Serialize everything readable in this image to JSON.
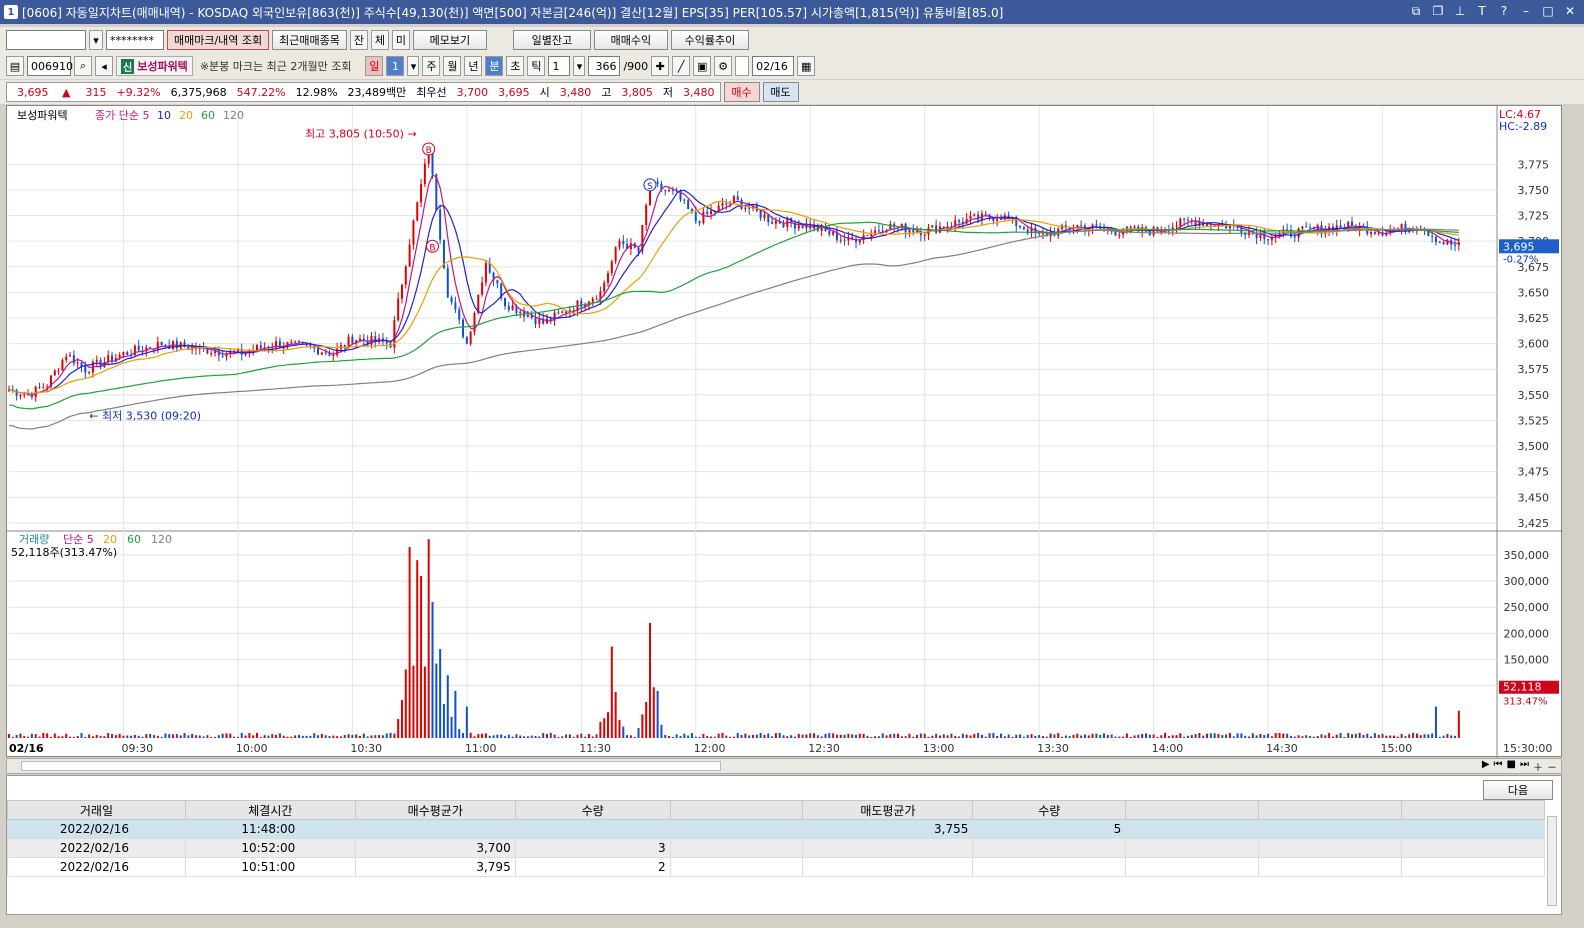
{
  "window": {
    "num": "1",
    "title": "[0606] 자동일지차트(매매내역) - KOSDAQ 외국인보유[863(천)] 주식수[49,130(천)] 액면[500] 자본금[246(억)] 결산[12월] EPS[35] PER[105.57] 시가총액[1,815(억)] 유통비율[85.0]"
  },
  "toolbar1": {
    "account": "",
    "password": "********",
    "mark_btn": "매매마크/내역 조회",
    "recent_btn": "최근매매종목",
    "jan": "잔",
    "che": "체",
    "mi": "미",
    "memo_btn": "메모보기",
    "daily_btn": "일별잔고",
    "profit_btn": "매매수익",
    "yield_btn": "수익률추이"
  },
  "toolbar2": {
    "code": "006910",
    "sin": "신",
    "name": "보성파워텍",
    "note": "※분봉 마크는 최근 2개월만 조회",
    "il": "일",
    "one": "1",
    "ju": "주",
    "wol": "월",
    "nyeon": "년",
    "bun": "분",
    "cho": "초",
    "tik": "틱",
    "interval": "1",
    "count": "366",
    "count_max": "/900",
    "date": "02/16"
  },
  "quote": {
    "price": "3,695",
    "arrow": "▲",
    "change": "315",
    "pct": "+9.32%",
    "volume": "6,375,968",
    "vol_pct": "547.22%",
    "turnover": "12.98%",
    "amount": "23,489백만",
    "order_label": "최우선",
    "ask": "3,700",
    "bid": "3,695",
    "open_label": "시",
    "open": "3,480",
    "high_label": "고",
    "high": "3,805",
    "low_label": "저",
    "low": "3,480",
    "buy_btn": "매수",
    "sell_btn": "매도"
  },
  "chart_data": [
    {
      "type": "line",
      "title": "보성파워텍",
      "legend": [
        "종가 단순 5",
        "10",
        "20",
        "60",
        "120"
      ],
      "colors": {
        "5": "#c0158a",
        "10": "#2020d0",
        "20": "#e8a000",
        "60": "#20a040",
        "120": "#808080",
        "up": "#e00000",
        "down": "#1050d0"
      },
      "ylim": [
        3420,
        3830
      ],
      "yticks": [
        3425,
        3450,
        3475,
        3500,
        3525,
        3550,
        3575,
        3600,
        3625,
        3650,
        3675,
        3700,
        3725,
        3750,
        3775
      ],
      "xticks": [
        "09:30",
        "10:00",
        "10:30",
        "11:00",
        "11:30",
        "12:00",
        "12:30",
        "13:00",
        "13:30",
        "14:00",
        "14:30",
        "15:00"
      ],
      "x_first_label": "02/16",
      "x_last_label": "15:30:00",
      "high_annotation": "최고 3,805 (10:50)",
      "low_annotation": "최저 3,530 (09:20)",
      "lc_label": "LC:4.67",
      "hc_label": "HC:-2.89",
      "current_price": "3,695",
      "current_pct": "-0.27%",
      "buy_markers": [
        {
          "t": "10:50",
          "price": 3790
        },
        {
          "t": "10:51",
          "price": 3695
        }
      ],
      "sell_markers": [
        {
          "t": "11:48",
          "price": 3755
        }
      ],
      "close_keyframes": [
        [
          "09:00",
          3555
        ],
        [
          "09:05",
          3550
        ],
        [
          "09:10",
          3560
        ],
        [
          "09:15",
          3590
        ],
        [
          "09:20",
          3575
        ],
        [
          "09:30",
          3590
        ],
        [
          "09:40",
          3600
        ],
        [
          "09:50",
          3595
        ],
        [
          "10:00",
          3590
        ],
        [
          "10:10",
          3600
        ],
        [
          "10:20",
          3595
        ],
        [
          "10:25",
          3590
        ],
        [
          "10:30",
          3605
        ],
        [
          "10:40",
          3600
        ],
        [
          "10:45",
          3700
        ],
        [
          "10:50",
          3790
        ],
        [
          "10:55",
          3650
        ],
        [
          "11:00",
          3600
        ],
        [
          "11:05",
          3680
        ],
        [
          "11:10",
          3640
        ],
        [
          "11:20",
          3620
        ],
        [
          "11:30",
          3640
        ],
        [
          "11:35",
          3650
        ],
        [
          "11:40",
          3700
        ],
        [
          "11:45",
          3690
        ],
        [
          "11:48",
          3755
        ],
        [
          "11:55",
          3745
        ],
        [
          "12:00",
          3720
        ],
        [
          "12:10",
          3740
        ],
        [
          "12:20",
          3720
        ],
        [
          "12:30",
          3715
        ],
        [
          "12:40",
          3700
        ],
        [
          "12:50",
          3715
        ],
        [
          "13:00",
          3710
        ],
        [
          "13:10",
          3720
        ],
        [
          "13:20",
          3725
        ],
        [
          "13:30",
          3705
        ],
        [
          "13:40",
          3715
        ],
        [
          "13:50",
          3710
        ],
        [
          "14:00",
          3710
        ],
        [
          "14:10",
          3720
        ],
        [
          "14:20",
          3715
        ],
        [
          "14:30",
          3705
        ],
        [
          "14:40",
          3710
        ],
        [
          "14:50",
          3715
        ],
        [
          "15:00",
          3710
        ],
        [
          "15:10",
          3715
        ],
        [
          "15:15",
          3700
        ],
        [
          "15:20",
          3695
        ]
      ]
    },
    {
      "type": "bar",
      "title": "거래량",
      "legend": [
        "단순 5",
        "20",
        "60",
        "120"
      ],
      "volume_label": "52,118주(313.47%)",
      "ylim": [
        0,
        390000
      ],
      "yticks": [
        100000,
        150000,
        200000,
        250000,
        300000,
        350000
      ],
      "ytick_labels": [
        "100,000",
        "150,000",
        "200,000",
        "250,000",
        "300,000",
        "350,000"
      ],
      "last_volume": "52,118",
      "last_pct": "313.47%",
      "spikes": [
        [
          "10:45",
          365000
        ],
        [
          "10:47",
          340000
        ],
        [
          "10:48",
          310000
        ],
        [
          "10:50",
          380000
        ],
        [
          "10:51",
          260000
        ],
        [
          "10:53",
          170000
        ],
        [
          "10:55",
          120000
        ],
        [
          "10:57",
          90000
        ],
        [
          "11:00",
          60000
        ],
        [
          "11:38",
          175000
        ],
        [
          "11:48",
          220000
        ],
        [
          "11:50",
          90000
        ],
        [
          "15:14",
          60000
        ],
        [
          "15:20",
          52118
        ]
      ]
    }
  ],
  "scroll_icons": [
    "▶",
    "⏮",
    "■",
    "⏭"
  ],
  "trade_table": {
    "next_btn": "다음",
    "headers": [
      "거래일",
      "체결시간",
      "매수평균가",
      "수량",
      "",
      "매도평균가",
      "수량",
      "",
      "",
      ""
    ],
    "rows": [
      [
        "2022/02/16",
        "11:48:00",
        "",
        "",
        "",
        "3,755",
        "5",
        "",
        "",
        ""
      ],
      [
        "2022/02/16",
        "10:52:00",
        "3,700",
        "3",
        "",
        "",
        "",
        "",
        "",
        ""
      ],
      [
        "2022/02/16",
        "10:51:00",
        "3,795",
        "2",
        "",
        "",
        "",
        "",
        "",
        ""
      ]
    ]
  }
}
